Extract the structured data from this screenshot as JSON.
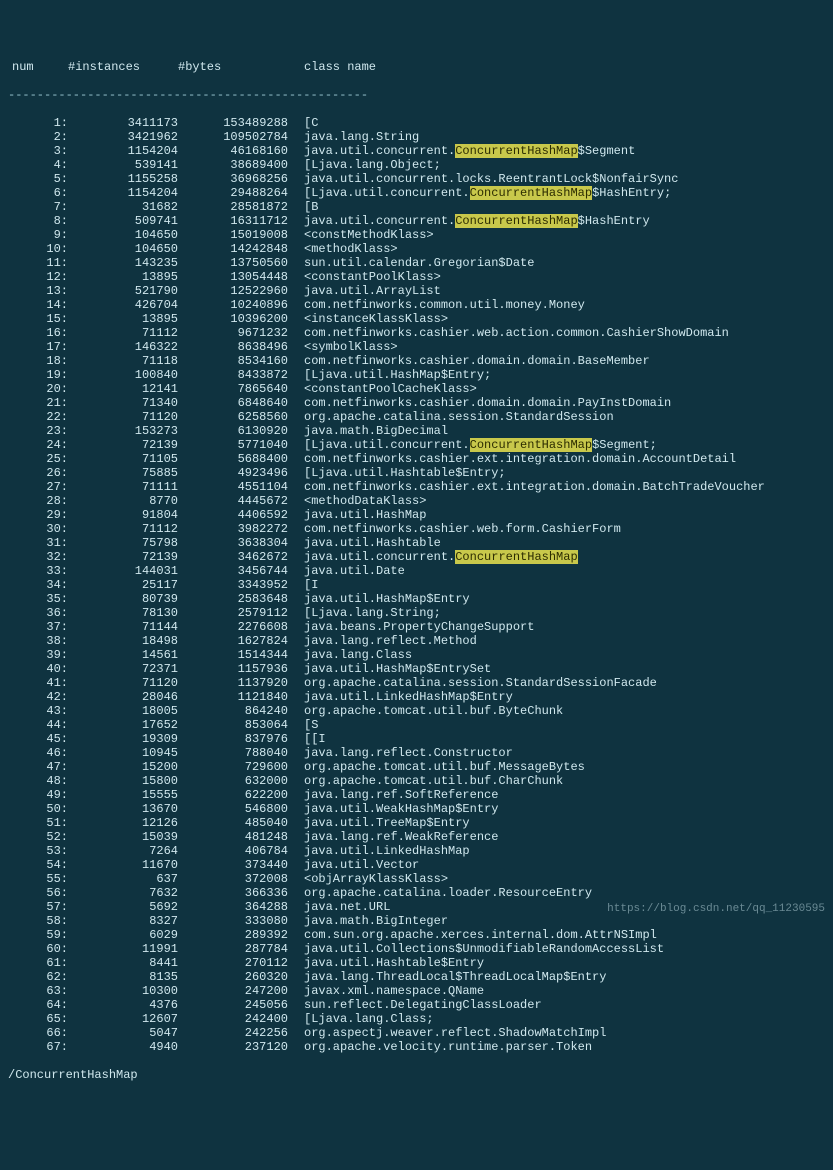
{
  "header": {
    "num": "num",
    "instances": "#instances",
    "bytes": "#bytes",
    "class": "class name"
  },
  "dashline": "--------------------------------------------------",
  "highlight": "ConcurrentHashMap",
  "footer": "/ConcurrentHashMap",
  "watermark": "https://blog.csdn.net/qq_11230595",
  "rows": [
    {
      "n": "1:",
      "i": "3411173",
      "b": "153489288",
      "c": "[C"
    },
    {
      "n": "2:",
      "i": "3421962",
      "b": "109502784",
      "c": "java.lang.String"
    },
    {
      "n": "3:",
      "i": "1154204",
      "b": "46168160",
      "c": "java.util.concurrent.ConcurrentHashMap$Segment"
    },
    {
      "n": "4:",
      "i": "539141",
      "b": "38689400",
      "c": "[Ljava.lang.Object;"
    },
    {
      "n": "5:",
      "i": "1155258",
      "b": "36968256",
      "c": "java.util.concurrent.locks.ReentrantLock$NonfairSync"
    },
    {
      "n": "6:",
      "i": "1154204",
      "b": "29488264",
      "c": "[Ljava.util.concurrent.ConcurrentHashMap$HashEntry;"
    },
    {
      "n": "7:",
      "i": "31682",
      "b": "28581872",
      "c": "[B"
    },
    {
      "n": "8:",
      "i": "509741",
      "b": "16311712",
      "c": "java.util.concurrent.ConcurrentHashMap$HashEntry"
    },
    {
      "n": "9:",
      "i": "104650",
      "b": "15019008",
      "c": "<constMethodKlass>"
    },
    {
      "n": "10:",
      "i": "104650",
      "b": "14242848",
      "c": "<methodKlass>"
    },
    {
      "n": "11:",
      "i": "143235",
      "b": "13750560",
      "c": "sun.util.calendar.Gregorian$Date"
    },
    {
      "n": "12:",
      "i": "13895",
      "b": "13054448",
      "c": "<constantPoolKlass>"
    },
    {
      "n": "13:",
      "i": "521790",
      "b": "12522960",
      "c": "java.util.ArrayList"
    },
    {
      "n": "14:",
      "i": "426704",
      "b": "10240896",
      "c": "com.netfinworks.common.util.money.Money"
    },
    {
      "n": "15:",
      "i": "13895",
      "b": "10396200",
      "c": "<instanceKlassKlass>"
    },
    {
      "n": "16:",
      "i": "71112",
      "b": "9671232",
      "c": "com.netfinworks.cashier.web.action.common.CashierShowDomain"
    },
    {
      "n": "17:",
      "i": "146322",
      "b": "8638496",
      "c": "<symbolKlass>"
    },
    {
      "n": "18:",
      "i": "71118",
      "b": "8534160",
      "c": "com.netfinworks.cashier.domain.domain.BaseMember"
    },
    {
      "n": "19:",
      "i": "100840",
      "b": "8433872",
      "c": "[Ljava.util.HashMap$Entry;"
    },
    {
      "n": "20:",
      "i": "12141",
      "b": "7865640",
      "c": "<constantPoolCacheKlass>"
    },
    {
      "n": "21:",
      "i": "71340",
      "b": "6848640",
      "c": "com.netfinworks.cashier.domain.domain.PayInstDomain"
    },
    {
      "n": "22:",
      "i": "71120",
      "b": "6258560",
      "c": "org.apache.catalina.session.StandardSession"
    },
    {
      "n": "23:",
      "i": "153273",
      "b": "6130920",
      "c": "java.math.BigDecimal"
    },
    {
      "n": "24:",
      "i": "72139",
      "b": "5771040",
      "c": "[Ljava.util.concurrent.ConcurrentHashMap$Segment;"
    },
    {
      "n": "25:",
      "i": "71105",
      "b": "5688400",
      "c": "com.netfinworks.cashier.ext.integration.domain.AccountDetail"
    },
    {
      "n": "26:",
      "i": "75885",
      "b": "4923496",
      "c": "[Ljava.util.Hashtable$Entry;"
    },
    {
      "n": "27:",
      "i": "71111",
      "b": "4551104",
      "c": "com.netfinworks.cashier.ext.integration.domain.BatchTradeVoucher"
    },
    {
      "n": "28:",
      "i": "8770",
      "b": "4445672",
      "c": "<methodDataKlass>"
    },
    {
      "n": "29:",
      "i": "91804",
      "b": "4406592",
      "c": "java.util.HashMap"
    },
    {
      "n": "30:",
      "i": "71112",
      "b": "3982272",
      "c": "com.netfinworks.cashier.web.form.CashierForm"
    },
    {
      "n": "31:",
      "i": "75798",
      "b": "3638304",
      "c": "java.util.Hashtable"
    },
    {
      "n": "32:",
      "i": "72139",
      "b": "3462672",
      "c": "java.util.concurrent.ConcurrentHashMap"
    },
    {
      "n": "33:",
      "i": "144031",
      "b": "3456744",
      "c": "java.util.Date"
    },
    {
      "n": "34:",
      "i": "25117",
      "b": "3343952",
      "c": "[I"
    },
    {
      "n": "35:",
      "i": "80739",
      "b": "2583648",
      "c": "java.util.HashMap$Entry"
    },
    {
      "n": "36:",
      "i": "78130",
      "b": "2579112",
      "c": "[Ljava.lang.String;"
    },
    {
      "n": "37:",
      "i": "71144",
      "b": "2276608",
      "c": "java.beans.PropertyChangeSupport"
    },
    {
      "n": "38:",
      "i": "18498",
      "b": "1627824",
      "c": "java.lang.reflect.Method"
    },
    {
      "n": "39:",
      "i": "14561",
      "b": "1514344",
      "c": "java.lang.Class"
    },
    {
      "n": "40:",
      "i": "72371",
      "b": "1157936",
      "c": "java.util.HashMap$EntrySet"
    },
    {
      "n": "41:",
      "i": "71120",
      "b": "1137920",
      "c": "org.apache.catalina.session.StandardSessionFacade"
    },
    {
      "n": "42:",
      "i": "28046",
      "b": "1121840",
      "c": "java.util.LinkedHashMap$Entry"
    },
    {
      "n": "43:",
      "i": "18005",
      "b": "864240",
      "c": "org.apache.tomcat.util.buf.ByteChunk"
    },
    {
      "n": "44:",
      "i": "17652",
      "b": "853064",
      "c": "[S"
    },
    {
      "n": "45:",
      "i": "19309",
      "b": "837976",
      "c": "[[I"
    },
    {
      "n": "46:",
      "i": "10945",
      "b": "788040",
      "c": "java.lang.reflect.Constructor"
    },
    {
      "n": "47:",
      "i": "15200",
      "b": "729600",
      "c": "org.apache.tomcat.util.buf.MessageBytes"
    },
    {
      "n": "48:",
      "i": "15800",
      "b": "632000",
      "c": "org.apache.tomcat.util.buf.CharChunk"
    },
    {
      "n": "49:",
      "i": "15555",
      "b": "622200",
      "c": "java.lang.ref.SoftReference"
    },
    {
      "n": "50:",
      "i": "13670",
      "b": "546800",
      "c": "java.util.WeakHashMap$Entry"
    },
    {
      "n": "51:",
      "i": "12126",
      "b": "485040",
      "c": "java.util.TreeMap$Entry"
    },
    {
      "n": "52:",
      "i": "15039",
      "b": "481248",
      "c": "java.lang.ref.WeakReference"
    },
    {
      "n": "53:",
      "i": "7264",
      "b": "406784",
      "c": "java.util.LinkedHashMap"
    },
    {
      "n": "54:",
      "i": "11670",
      "b": "373440",
      "c": "java.util.Vector"
    },
    {
      "n": "55:",
      "i": "637",
      "b": "372008",
      "c": "<objArrayKlassKlass>"
    },
    {
      "n": "56:",
      "i": "7632",
      "b": "366336",
      "c": "org.apache.catalina.loader.ResourceEntry"
    },
    {
      "n": "57:",
      "i": "5692",
      "b": "364288",
      "c": "java.net.URL"
    },
    {
      "n": "58:",
      "i": "8327",
      "b": "333080",
      "c": "java.math.BigInteger"
    },
    {
      "n": "59:",
      "i": "6029",
      "b": "289392",
      "c": "com.sun.org.apache.xerces.internal.dom.AttrNSImpl"
    },
    {
      "n": "60:",
      "i": "11991",
      "b": "287784",
      "c": "java.util.Collections$UnmodifiableRandomAccessList"
    },
    {
      "n": "61:",
      "i": "8441",
      "b": "270112",
      "c": "java.util.Hashtable$Entry"
    },
    {
      "n": "62:",
      "i": "8135",
      "b": "260320",
      "c": "java.lang.ThreadLocal$ThreadLocalMap$Entry"
    },
    {
      "n": "63:",
      "i": "10300",
      "b": "247200",
      "c": "javax.xml.namespace.QName"
    },
    {
      "n": "64:",
      "i": "4376",
      "b": "245056",
      "c": "sun.reflect.DelegatingClassLoader"
    },
    {
      "n": "65:",
      "i": "12607",
      "b": "242400",
      "c": "[Ljava.lang.Class;"
    },
    {
      "n": "66:",
      "i": "5047",
      "b": "242256",
      "c": "org.aspectj.weaver.reflect.ShadowMatchImpl"
    },
    {
      "n": "67:",
      "i": "4940",
      "b": "237120",
      "c": "org.apache.velocity.runtime.parser.Token"
    }
  ]
}
